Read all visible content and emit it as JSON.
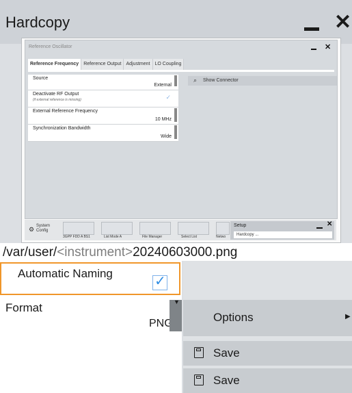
{
  "window": {
    "title": "Hardcopy"
  },
  "preview": {
    "dialog_title": "Reference Oscillator",
    "tabs": [
      {
        "label": "Reference Frequency"
      },
      {
        "label": "Reference Output"
      },
      {
        "label": "Adjustment"
      },
      {
        "label": "LO Coupling"
      }
    ],
    "rows": [
      {
        "label": "Source",
        "value": "External"
      },
      {
        "label": "Deactivate RF Output",
        "sub": "(if external reference is missing)"
      },
      {
        "label": "External Reference Frequency",
        "value": "10 MHz"
      },
      {
        "label": "Synchronization Bandwidth",
        "value": "Wide"
      }
    ],
    "show_connector": "Show Connector",
    "taskbar": {
      "system_config_line1": "System",
      "system_config_line2": "Config",
      "thumbs": [
        "3GPP FDD A BS1",
        "List Mode A",
        "File Manager",
        "Select List",
        "Netwo"
      ],
      "setup_title": "Setup",
      "setup_item": "Hardcopy ..."
    }
  },
  "path": {
    "prefix": "/var/user/",
    "placeholder": "<instrument>",
    "suffix": "20240603000.png"
  },
  "automatic_naming": {
    "label": "Automatic Naming",
    "checked": true
  },
  "format": {
    "label": "Format",
    "value": "PNG"
  },
  "buttons": {
    "options": "Options",
    "save1": "Save",
    "save2": "Save"
  },
  "colors": {
    "highlight": "#f0962a",
    "checkbox": "#2f8de4"
  }
}
